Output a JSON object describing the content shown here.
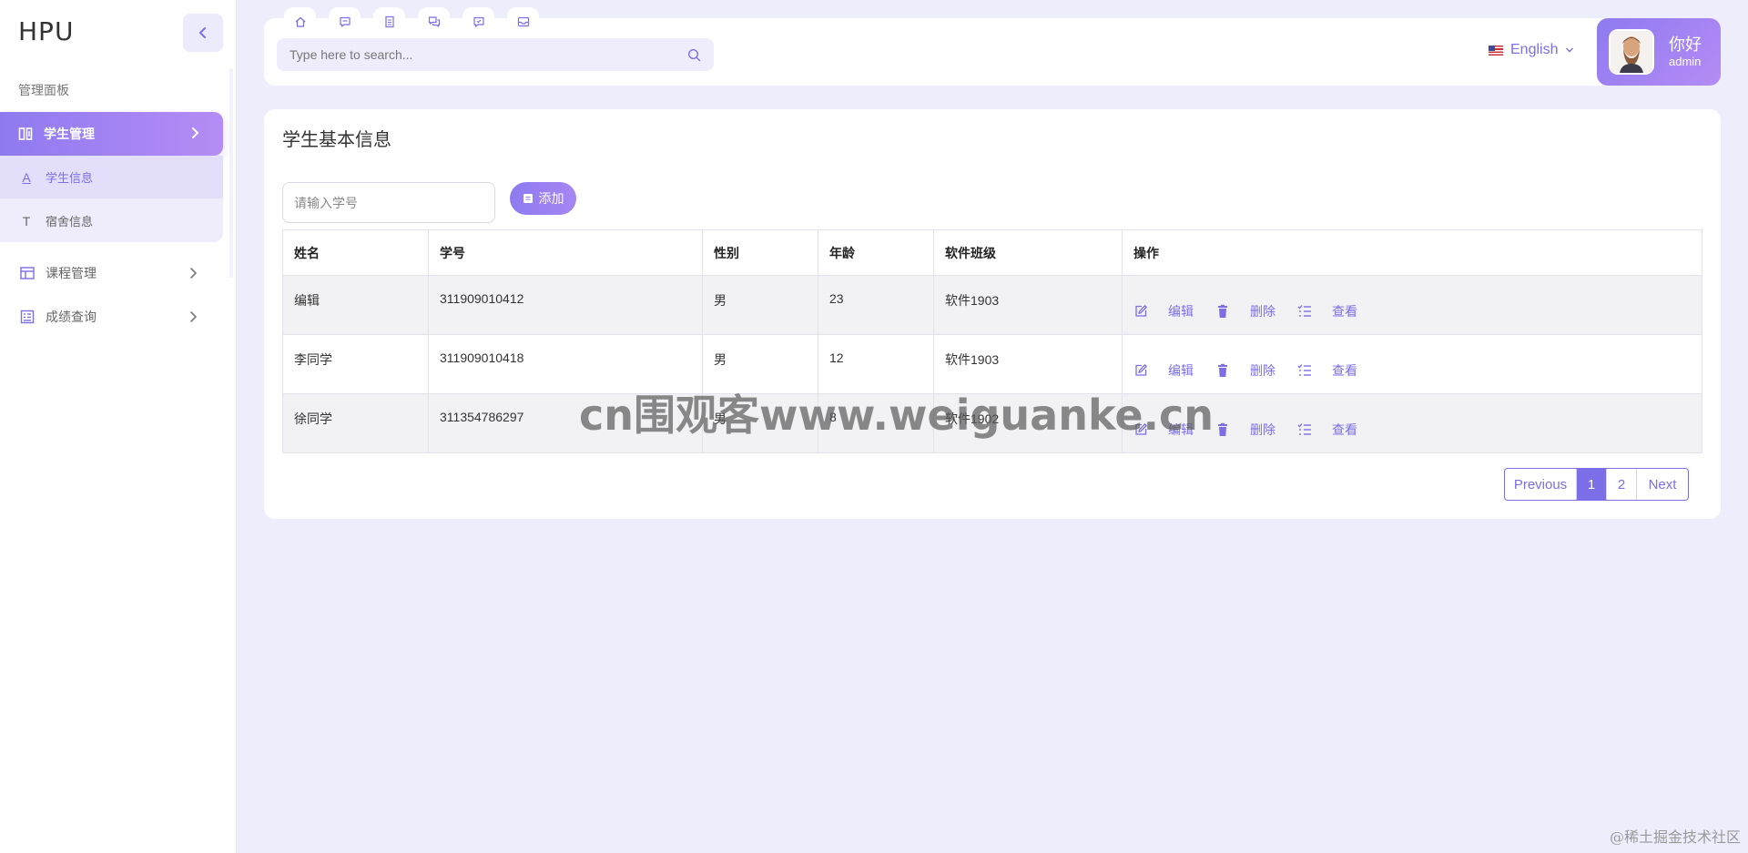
{
  "sidebar": {
    "brand": "HPU",
    "section_title": "管理面板",
    "active_menu": {
      "label": "学生管理",
      "icon": "columns-icon"
    },
    "submenu": [
      {
        "label": "学生信息",
        "glyph": "A",
        "active": true
      },
      {
        "label": "宿舍信息",
        "glyph": "T",
        "active": false
      }
    ],
    "menu": [
      {
        "label": "课程管理",
        "icon": "table-icon"
      },
      {
        "label": "成绩查询",
        "icon": "calendar-list-icon"
      }
    ]
  },
  "header": {
    "quick_icons": [
      "home-icon",
      "message-icon",
      "document-icon",
      "chat-icon",
      "comment-icon",
      "inbox-icon"
    ],
    "search_placeholder": "Type here to search...",
    "language": "English",
    "greeting": "你好",
    "username": "admin"
  },
  "main": {
    "title": "学生基本信息",
    "input_placeholder": "请输入学号",
    "add_label": "添加",
    "columns": [
      "姓名",
      "学号",
      "性别",
      "年龄",
      "软件班级",
      "操作"
    ],
    "rows": [
      {
        "name": "编辑",
        "id": "311909010412",
        "gender": "男",
        "age": "23",
        "class": "软件1903"
      },
      {
        "name": "李同学",
        "id": "311909010418",
        "gender": "男",
        "age": "12",
        "class": "软件1903"
      },
      {
        "name": "徐同学",
        "id": "311354786297",
        "gender": "男",
        "age": "8",
        "class": "软件1902"
      }
    ],
    "actions": {
      "edit": "编辑",
      "delete": "删除",
      "view": "查看"
    },
    "pagination": {
      "prev": "Previous",
      "pages": [
        "1",
        "2"
      ],
      "next": "Next",
      "current": "1"
    }
  },
  "watermark": "cn围观客www.weiguanke.cn",
  "footer_credit": "@稀土掘金技术社区",
  "colors": {
    "accent": "#7b6ee6",
    "background": "#eeedfb"
  }
}
